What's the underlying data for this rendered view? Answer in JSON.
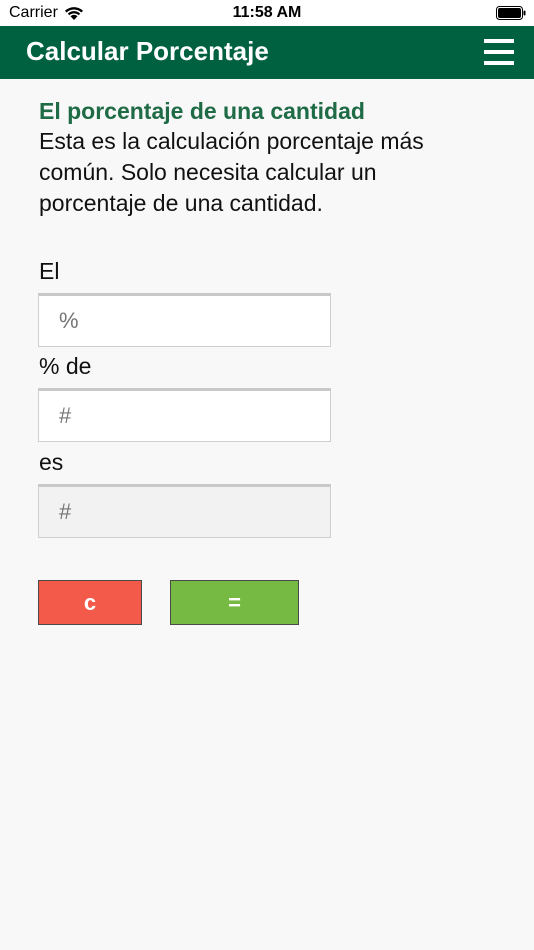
{
  "status_bar": {
    "carrier": "Carrier",
    "time": "11:58 AM"
  },
  "header": {
    "title": "Calcular Porcentaje",
    "background": "#006140"
  },
  "section": {
    "title": "El porcentaje de una cantidad",
    "description": "Esta es la calculación porcentaje más común. Solo necesita calcular un porcentaje de una cantidad."
  },
  "form": {
    "label_1": "El",
    "field_1_placeholder": "%",
    "label_2": "% de",
    "field_2_placeholder": "#",
    "label_3": "es",
    "result_placeholder": "#"
  },
  "buttons": {
    "clear_label": "c",
    "clear_color": "#f45a4a",
    "equals_label": "=",
    "equals_color": "#76b943"
  }
}
